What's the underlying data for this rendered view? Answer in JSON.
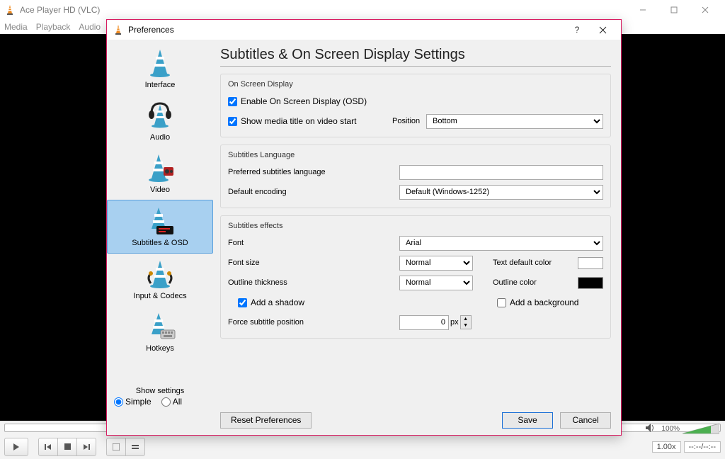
{
  "app": {
    "title": "Ace Player HD (VLC)",
    "menu": [
      "Media",
      "Playback",
      "Audio"
    ],
    "zoom": "1.00x",
    "time": "--:--/--:--",
    "vol_pct": "100%"
  },
  "pref": {
    "title": "Preferences",
    "page_title": "Subtitles & On Screen Display Settings",
    "categories": [
      {
        "label": "Interface"
      },
      {
        "label": "Audio"
      },
      {
        "label": "Video"
      },
      {
        "label": "Subtitles & OSD"
      },
      {
        "label": "Input & Codecs"
      },
      {
        "label": "Hotkeys"
      }
    ],
    "show_settings_label": "Show settings",
    "show_settings": {
      "simple": "Simple",
      "all": "All"
    },
    "osd": {
      "group": "On Screen Display",
      "enable": "Enable On Screen Display (OSD)",
      "show_title": "Show media title on video start",
      "position_label": "Position",
      "position_value": "Bottom"
    },
    "lang": {
      "group": "Subtitles Language",
      "preferred": "Preferred subtitles language",
      "preferred_value": "",
      "encoding": "Default encoding",
      "encoding_value": "Default (Windows-1252)"
    },
    "fx": {
      "group": "Subtitles effects",
      "font": "Font",
      "font_value": "Arial",
      "font_size": "Font size",
      "font_size_value": "Normal",
      "text_color": "Text default color",
      "outline_thick": "Outline thickness",
      "outline_thick_value": "Normal",
      "outline_color": "Outline color",
      "add_shadow": "Add a shadow",
      "add_bg": "Add a background",
      "force_pos": "Force subtitle position",
      "force_pos_value": "0",
      "force_pos_unit": "px"
    },
    "buttons": {
      "reset": "Reset Preferences",
      "save": "Save",
      "cancel": "Cancel"
    }
  }
}
